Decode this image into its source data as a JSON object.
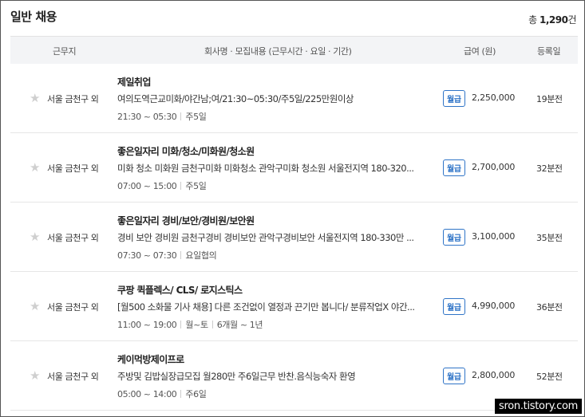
{
  "header": {
    "title": "일반 채용",
    "total_prefix": "총",
    "total_count": "1,290",
    "total_suffix": "건"
  },
  "columns": {
    "location": "근무지",
    "description": "회사명 · 모집내용 (근무시간 · 요일 · 기간)",
    "salary": "급여 (원)",
    "posted": "등록일"
  },
  "listings": [
    {
      "location": "서울 금천구 외",
      "company": "제일취업",
      "description": "여의도역근교미화/야간남;여/21:30~05:30/주5일/225만원이상",
      "time": "21:30 ~ 05:30",
      "days": "주5일",
      "period": "",
      "pay_type": "월급",
      "salary": "2,250,000",
      "posted": "19분전"
    },
    {
      "location": "서울 금천구 외",
      "company": "좋은일자리 미화/청소/미화원/청소원",
      "description": "미화 청소 미화원 금천구미화 미화청소 관악구미화 청소원 서울전지역 180-320...",
      "time": "07:00 ~ 15:00",
      "days": "주5일",
      "period": "",
      "pay_type": "월급",
      "salary": "2,700,000",
      "posted": "32분전"
    },
    {
      "location": "서울 금천구 외",
      "company": "좋은일자리 경비/보안/경비원/보안원",
      "description": "경비 보안 경비원 금천구경비 경비보안 관악구경비보안 서울전지역 180-330만 ...",
      "time": "07:30 ~ 07:30",
      "days": "요일협의",
      "period": "",
      "pay_type": "월급",
      "salary": "3,100,000",
      "posted": "35분전"
    },
    {
      "location": "서울 금천구 외",
      "company": "쿠팡 퀵플렉스/ CLS/ 로지스틱스",
      "description": "[월500 소화물 기사 채용] 다른 조건없이 열정과 끈기만 봅니다/ 분류작업X 야간...",
      "time": "11:00 ~ 19:00",
      "days": "월~토",
      "period": "6개월 ~ 1년",
      "pay_type": "월급",
      "salary": "4,990,000",
      "posted": "36분전"
    },
    {
      "location": "서울 금천구 외",
      "company": "케이먹방제이프로",
      "description": "주방및 김밥실장급모집 월280만 주6일근무 반찬.음식능숙자 환영",
      "time": "05:00 ~ 14:00",
      "days": "주6일",
      "period": "",
      "pay_type": "월급",
      "salary": "2,800,000",
      "posted": "52분전"
    }
  ],
  "watermark": "sron.tistory.com",
  "colors": {
    "badge": "#2f74c7",
    "header_bg": "#f3f4f6",
    "star": "#cfcfcf"
  }
}
